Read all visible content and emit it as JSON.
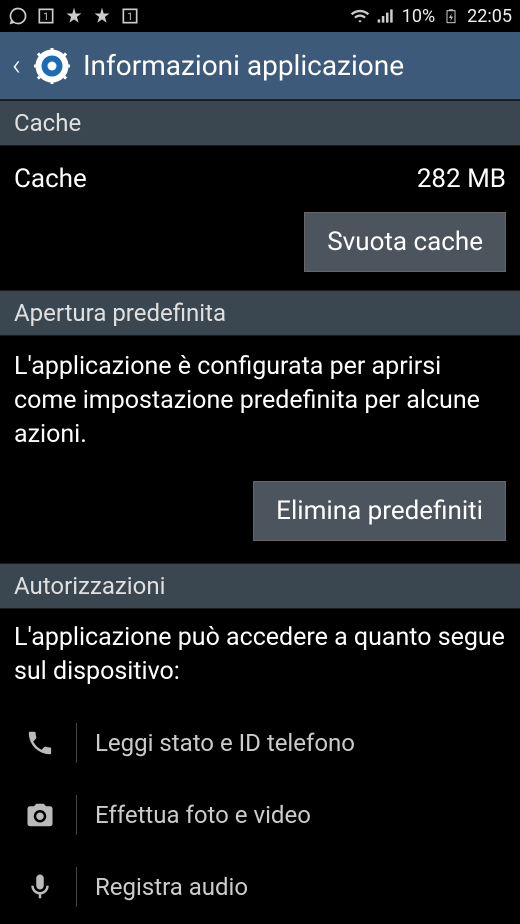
{
  "status_bar": {
    "battery_percent": "10%",
    "time": "22:05"
  },
  "header": {
    "title": "Informazioni applicazione"
  },
  "cache": {
    "section_title": "Cache",
    "label": "Cache",
    "value": "282 MB",
    "clear_button": "Svuota cache"
  },
  "default_launch": {
    "section_title": "Apertura predefinita",
    "description": "L'applicazione è configurata per aprirsi come impostazione predefinita per alcune azioni.",
    "clear_button": "Elimina predefiniti"
  },
  "permissions": {
    "section_title": "Autorizzazioni",
    "intro": "L'applicazione può accedere a quanto segue sul dispositivo:",
    "items": [
      {
        "icon": "phone",
        "label": "Leggi stato e ID telefono"
      },
      {
        "icon": "camera",
        "label": "Effettua foto e video"
      },
      {
        "icon": "mic",
        "label": "Registra audio"
      }
    ]
  }
}
